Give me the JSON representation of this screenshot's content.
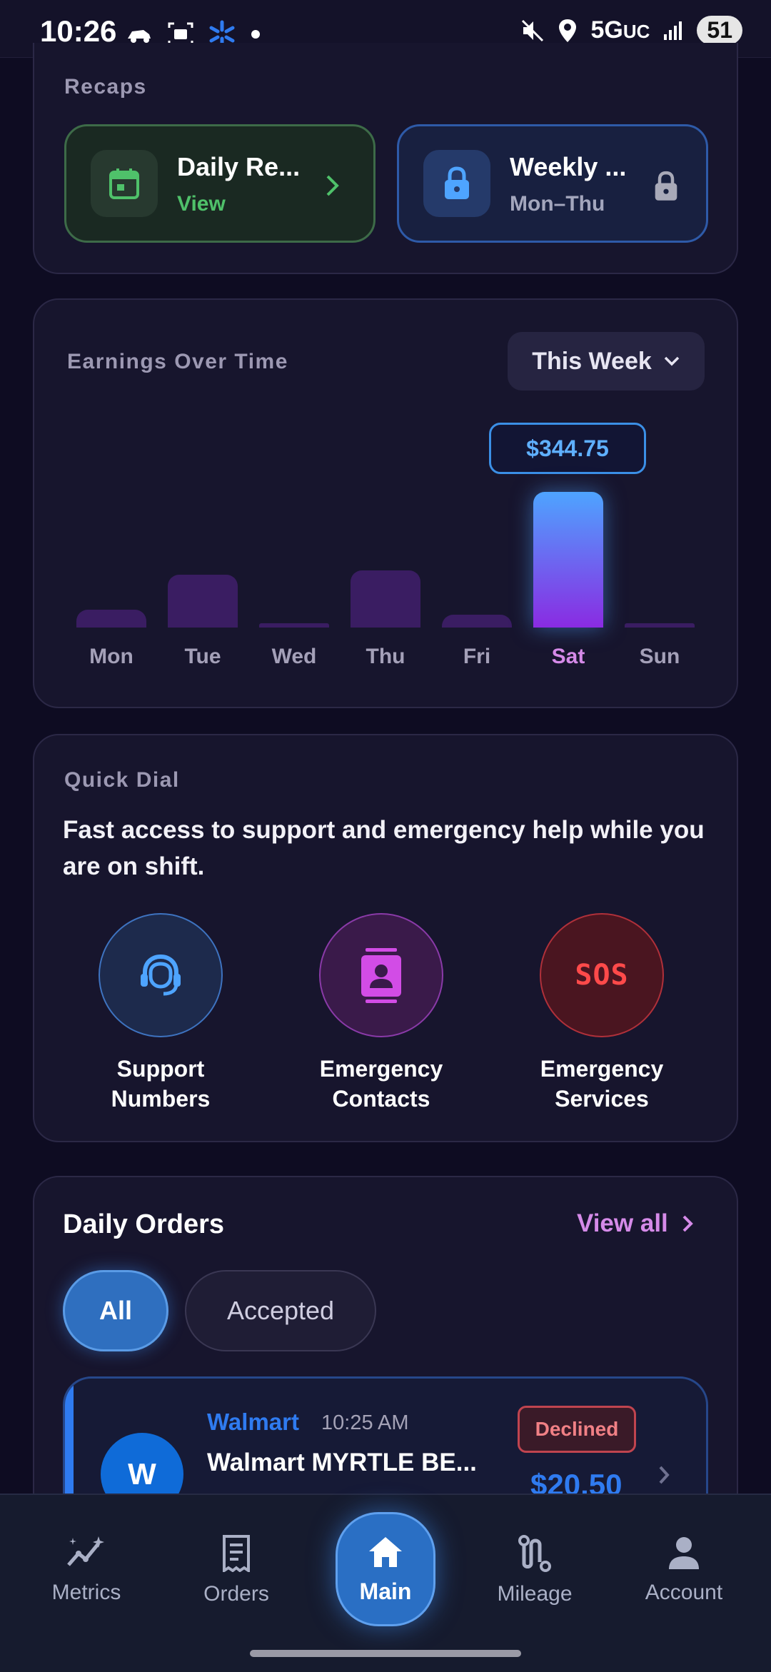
{
  "status_bar": {
    "time": "10:26",
    "network": "5G",
    "network_suffix": "UC",
    "battery": "51"
  },
  "recaps": {
    "label": "Recaps",
    "daily": {
      "title": "Daily Re...",
      "subtitle": "View"
    },
    "weekly": {
      "title": "Weekly ...",
      "subtitle": "Mon–Thu"
    }
  },
  "earnings": {
    "label": "Earnings Over Time",
    "range_selector": "This Week",
    "tooltip": "$344.75",
    "colors": {
      "bar": "#3a1d62",
      "highlight_top": "#4ea4ff",
      "highlight_bottom": "#8a2be2",
      "highlight_label": "#d58ae8"
    }
  },
  "chart_data": {
    "type": "bar",
    "categories": [
      "Mon",
      "Tue",
      "Wed",
      "Thu",
      "Fri",
      "Sat",
      "Sun"
    ],
    "values": [
      45,
      134,
      8,
      145,
      32,
      344.75,
      8
    ],
    "highlighted": "Sat",
    "ylim": [
      0,
      360
    ],
    "grid": false
  },
  "quick_dial": {
    "label": "Quick Dial",
    "description": "Fast access to support and emergency help while you are on shift.",
    "items": [
      {
        "line1": "Support",
        "line2": "Numbers",
        "icon": "headset-icon"
      },
      {
        "line1": "Emergency",
        "line2": "Contacts",
        "icon": "contact-card-icon"
      },
      {
        "line1": "Emergency",
        "line2": "Services",
        "icon": "sos-icon",
        "icon_text": "SOS"
      }
    ]
  },
  "daily_orders": {
    "title": "Daily Orders",
    "view_all": "View all",
    "filters": [
      "All",
      "Accepted"
    ],
    "orders": [
      {
        "avatar": "W",
        "store": "Walmart",
        "time": "10:25 AM",
        "name": "Walmart MYRTLE BE...",
        "status": "Declined",
        "amount": "$20.50"
      }
    ]
  },
  "nav": {
    "items": [
      {
        "label": "Metrics",
        "icon": "metrics-icon"
      },
      {
        "label": "Orders",
        "icon": "receipt-icon"
      },
      {
        "label": "Main",
        "icon": "home-icon"
      },
      {
        "label": "Mileage",
        "icon": "route-icon"
      },
      {
        "label": "Account",
        "icon": "person-icon"
      }
    ]
  }
}
